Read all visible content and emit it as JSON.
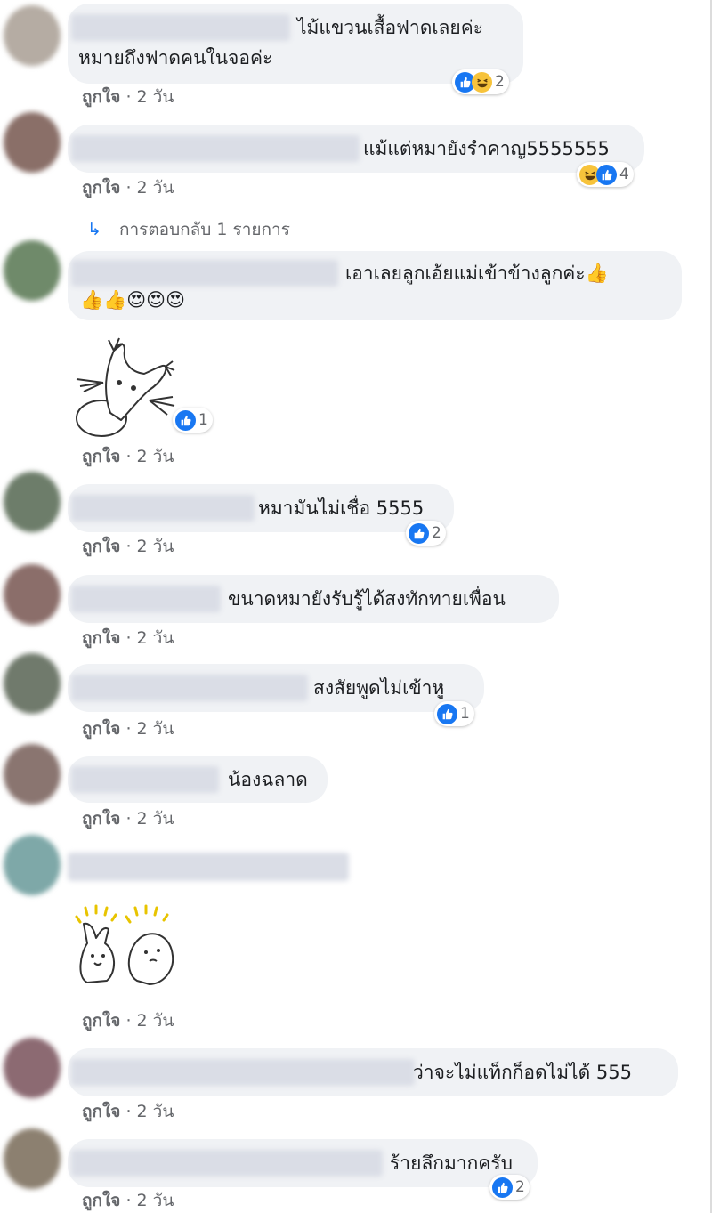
{
  "like_label": "ถูกใจ",
  "comments": [
    {
      "text1": "ไม้แขวนเสื้อฟาดเลยค่ะ",
      "text2": "หมายถึงฟาดคนในจอค่ะ",
      "time": "· 2 วัน",
      "reactions": 2
    },
    {
      "text": "แม้แต่หมายังรำคาญ5555555",
      "time": "· 2 วัน",
      "reactions": 4
    },
    {
      "text1": "เอาเลยลูกเอ้ยแม่เข้าข้างลูกค่ะ👍",
      "text2": "👍👍😍😍😍"
    },
    {
      "time": "· 2 วัน",
      "reactions": 1
    },
    {
      "text": "หมามันไม่เชื่อ 5555",
      "time": "· 2 วัน",
      "reactions": 2
    },
    {
      "text": "ขนาดหมายังรับรู้ได้สงทักทายเพื่อน",
      "time": "· 2 วัน"
    },
    {
      "text": "สงสัยพูดไม่เข้าหู",
      "time": "· 2 วัน",
      "reactions": 1
    },
    {
      "text": "น้องฉลาด",
      "time": "· 2 วัน"
    },
    {
      "time": "· 2 วัน"
    },
    {
      "text": "ว่าจะไม่แท็กก็อดไม่ได้ 555",
      "time": "· 2 วัน"
    },
    {
      "text": "ร้ายลึกมากครับ",
      "time": "· 2 วัน",
      "reactions": 2
    }
  ],
  "reply_link": {
    "arrow": "↳",
    "label": "การตอบกลับ 1 รายการ"
  },
  "colors": {
    "like_blue": "#1877f2",
    "haha_yellow": "#f7c33b",
    "bubble_gray": "#f0f2f5",
    "meta_gray": "#65676b"
  }
}
